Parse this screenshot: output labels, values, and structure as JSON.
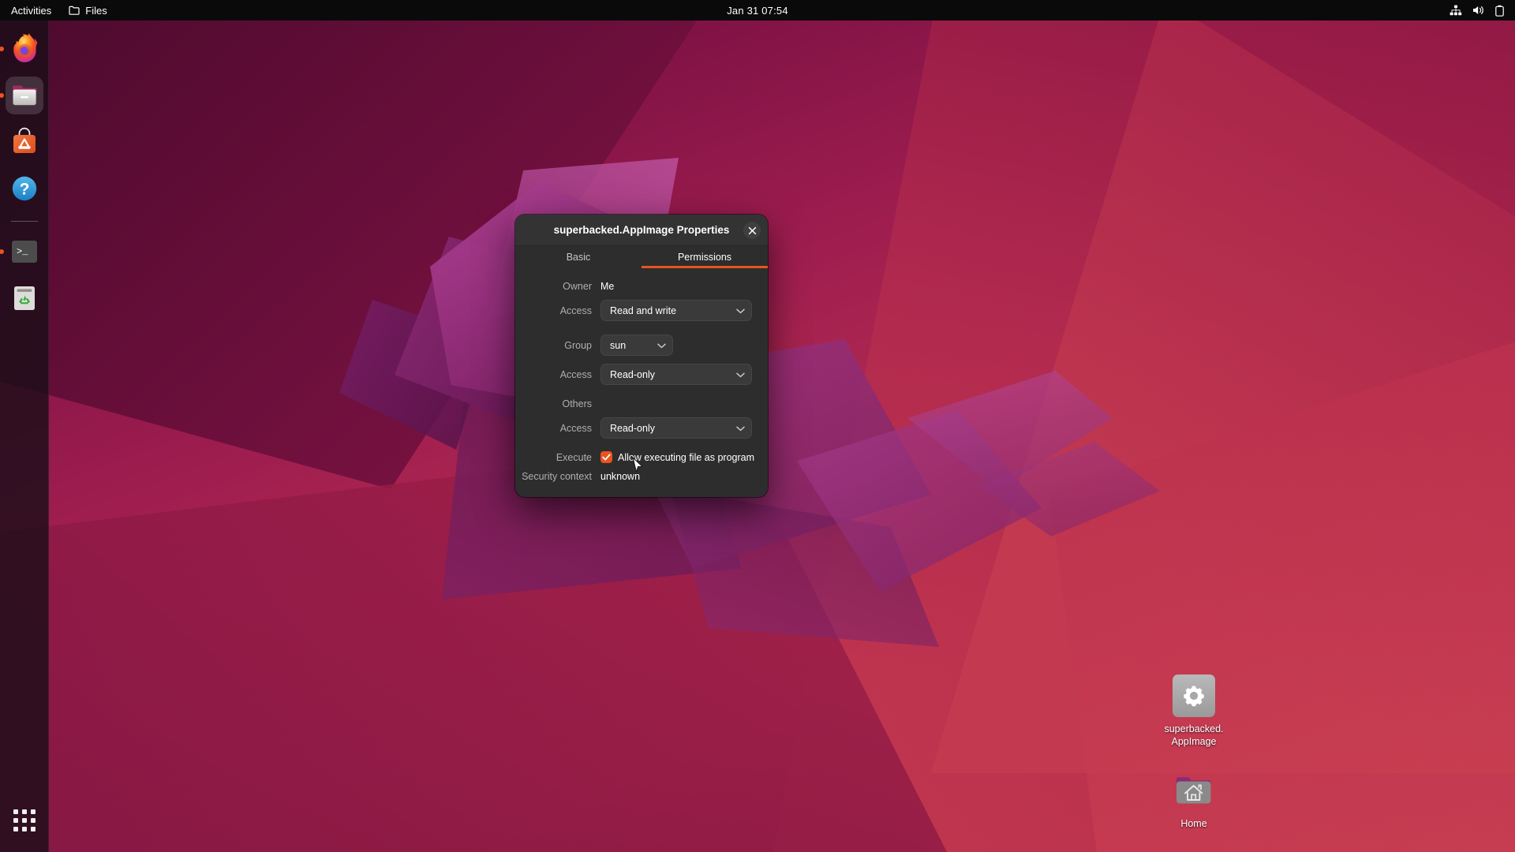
{
  "topbar": {
    "activities": "Activities",
    "app_name": "Files",
    "clock": "Jan 31  07:54",
    "tray": [
      "network-wired-icon",
      "volume-icon",
      "battery-icon"
    ]
  },
  "dock": {
    "items": [
      {
        "name": "firefox",
        "label": "Firefox",
        "running": true,
        "active": false
      },
      {
        "name": "files",
        "label": "Files",
        "running": true,
        "active": true
      },
      {
        "name": "ubuntu-software",
        "label": "Ubuntu Software",
        "running": false,
        "active": false
      },
      {
        "name": "help",
        "label": "Help",
        "running": false,
        "active": false
      },
      {
        "name": "terminal",
        "label": "Terminal",
        "running": true,
        "active": false
      },
      {
        "name": "trash",
        "label": "Trash",
        "running": false,
        "active": false
      }
    ],
    "show_apps": "Show Applications"
  },
  "desktop_icons": [
    {
      "name": "superbacked-appimage",
      "label": "superbacked.\nAppImage",
      "icon": "gear-icon"
    },
    {
      "name": "home",
      "label": "Home",
      "icon": "home-folder-icon"
    }
  ],
  "dialog": {
    "title": "superbacked.AppImage Properties",
    "close_label": "Close",
    "tabs": [
      {
        "label": "Basic",
        "active": false
      },
      {
        "label": "Permissions",
        "active": true
      }
    ],
    "accent_color": "#e95420",
    "rows": {
      "owner_label": "Owner",
      "owner_value": "Me",
      "owner_access_label": "Access",
      "owner_access_value": "Read and write",
      "group_label": "Group",
      "group_value": "sun",
      "group_access_label": "Access",
      "group_access_value": "Read-only",
      "others_label": "Others",
      "others_access_label": "Access",
      "others_access_value": "Read-only",
      "execute_label": "Execute",
      "execute_checkbox_label": "Allow executing file as program",
      "execute_checked": true,
      "security_label": "Security context",
      "security_value": "unknown"
    }
  }
}
